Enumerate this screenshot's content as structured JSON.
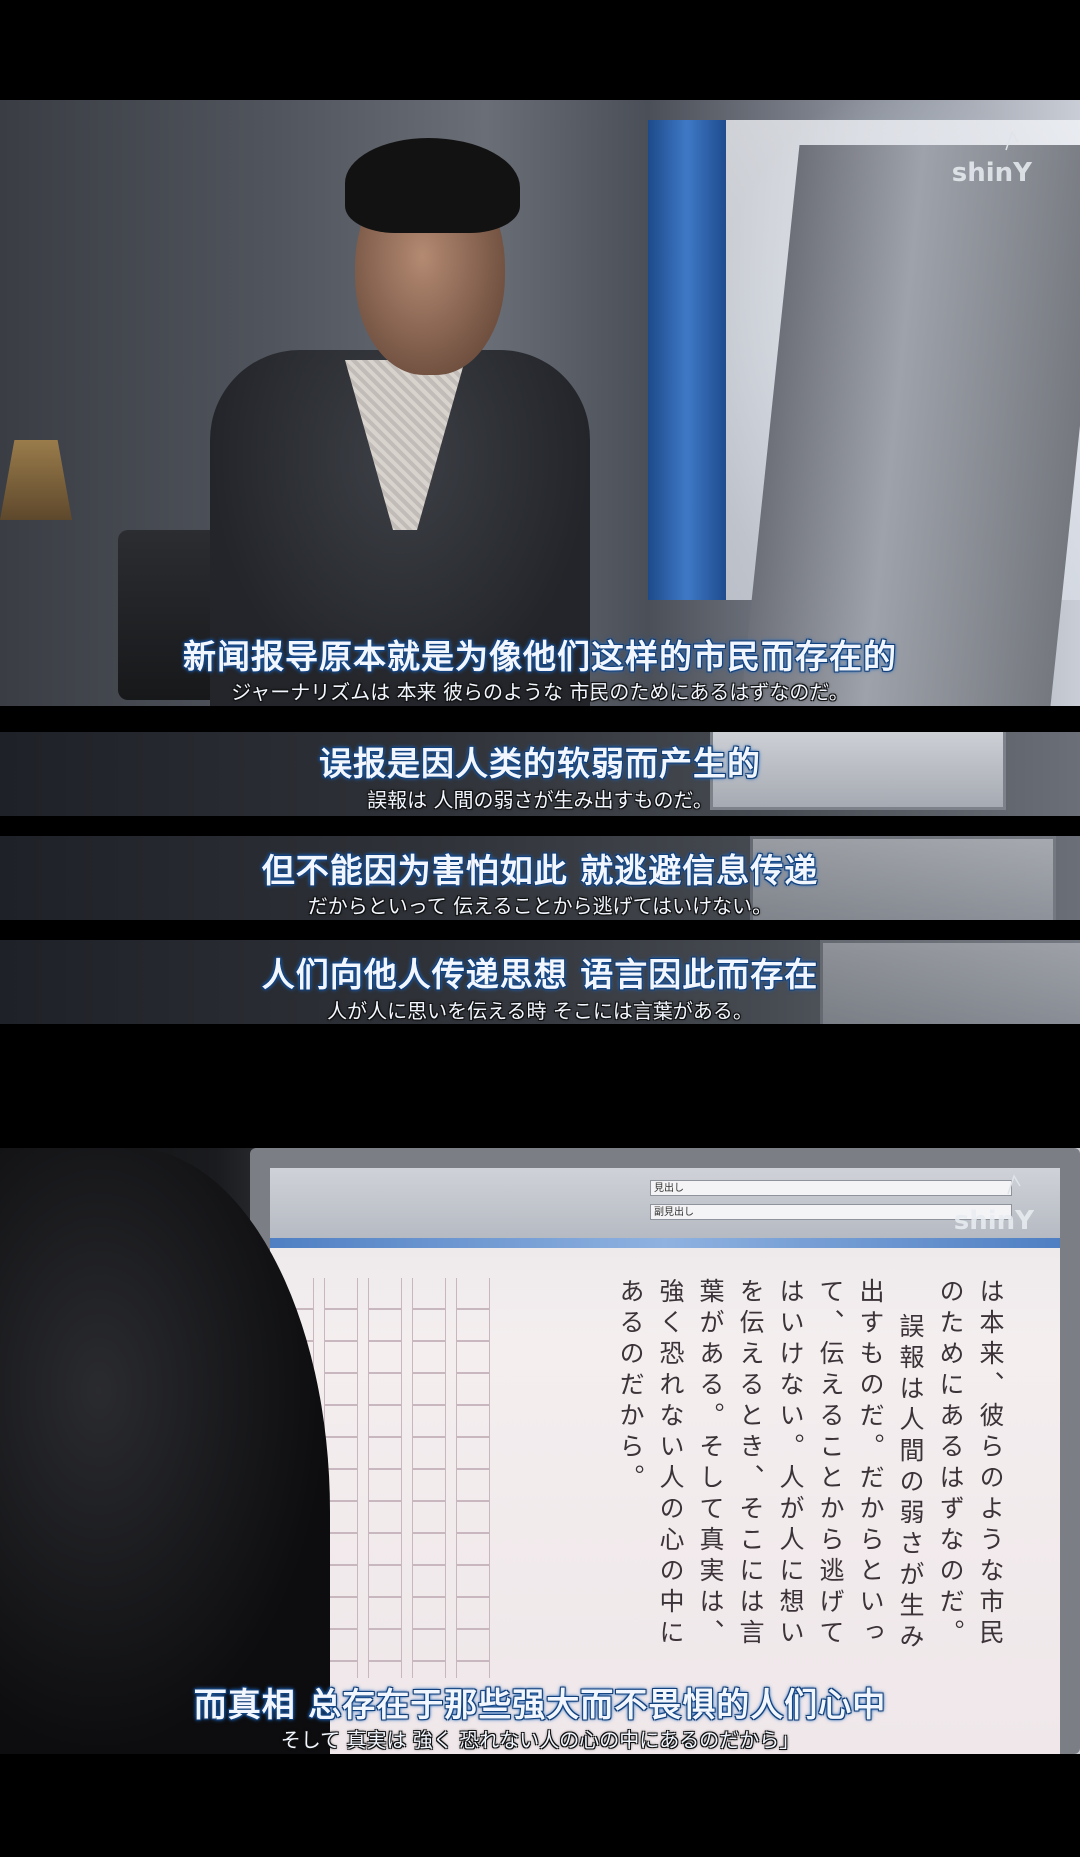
{
  "watermark": "shinY",
  "panels": [
    {
      "subtitle_zh": "新闻报导原本就是为像他们这样的市民而存在的",
      "subtitle_ja": "ジャーナリズムは 本来 彼らのような 市民のためにあるはずなのだ。"
    },
    {
      "subtitle_zh": "误报是因人类的软弱而产生的",
      "subtitle_ja": "誤報は 人間の弱さが生み出すものだ。"
    },
    {
      "subtitle_zh": "但不能因为害怕如此 就逃避信息传递",
      "subtitle_ja": "だからといって 伝えることから逃げてはいけない。"
    },
    {
      "subtitle_zh": "人们向他人传递思想 语言因此而存在",
      "subtitle_ja": "人が人に思いを伝える時 そこには言葉がある。"
    },
    {
      "subtitle_zh": "而真相 总存在于那些强大而不畏惧的人们心中",
      "subtitle_ja": "そして 真実は 強く 恐れない人の心の中にあるのだから」"
    }
  ],
  "screen": {
    "toolbar_field_1": "見出し",
    "toolbar_field_2": "副見出し",
    "manuscript_columns": [
      "は本来、彼らのような市民",
      "のためにあるはずなのだ。",
      "誤報は人間の弱さが生み",
      "出すものだ。だからといっ",
      "て、伝えることから逃げて",
      "はいけない。人が人に想い",
      "を伝えるとき、そこには言",
      "葉がある。そして真実は、",
      "強く恐れない人の心の中に",
      "あるのだから。"
    ]
  }
}
